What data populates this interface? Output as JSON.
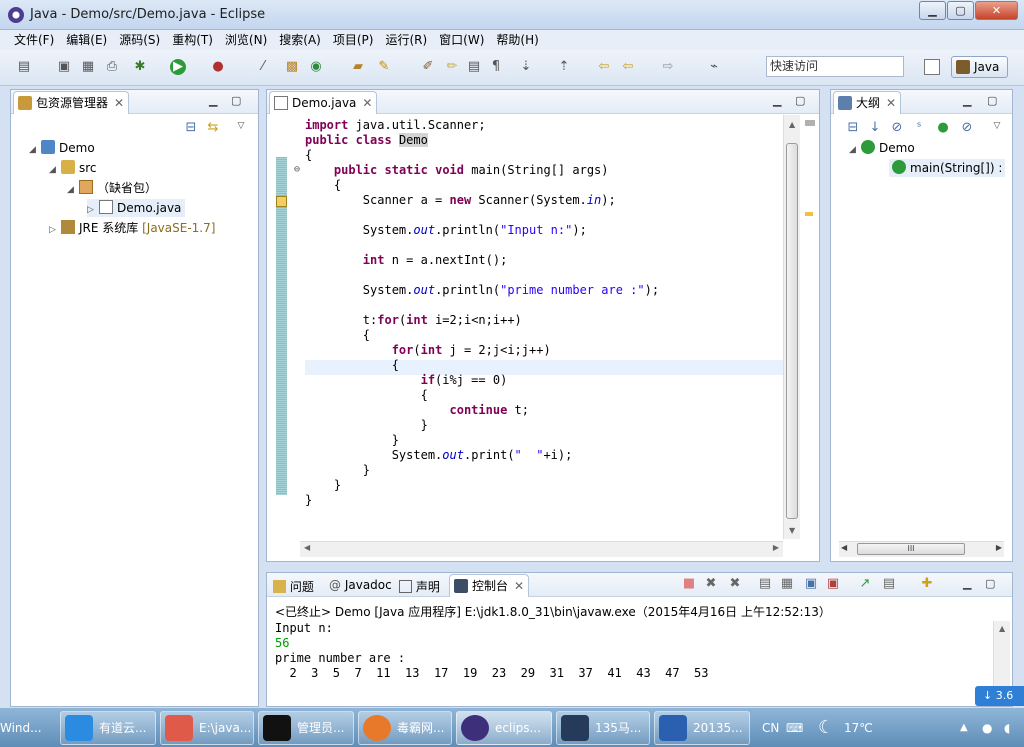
{
  "window": {
    "title": "Java  -  Demo/src/Demo.java  -  Eclipse"
  },
  "menu": [
    "文件(F)",
    "编辑(E)",
    "源码(S)",
    "重构(T)",
    "浏览(N)",
    "搜索(A)",
    "项目(P)",
    "运行(R)",
    "窗口(W)",
    "帮助(H)"
  ],
  "toolbar": {
    "quick_access_value": "快速访问",
    "perspective_label": "Java"
  },
  "package_explorer": {
    "tab_label": "包资源管理器",
    "tree": [
      {
        "label": "Demo"
      },
      {
        "label": "src"
      },
      {
        "label": "（缺省包）"
      },
      {
        "label": "Demo.java"
      },
      {
        "label": "JRE 系统库",
        "decoration": "[JavaSE-1.7]"
      }
    ]
  },
  "editor": {
    "tab_label": "Demo.java",
    "lines": [
      "import java.util.Scanner;",
      "public class Demo",
      "{",
      "    public static void main(String[] args)",
      "    {",
      "        Scanner a = new Scanner(System.in);",
      "",
      "        System.out.println(\"Input n:\");",
      "",
      "        int n = a.nextInt();",
      "",
      "        System.out.println(\"prime number are :\");",
      "",
      "        t:for(int i=2;i<n;i++)",
      "        {",
      "            for(int j = 2;j<i;j++)",
      "            {",
      "                if(i%j == 0)",
      "                {",
      "                    continue t;",
      "                }",
      "            }",
      "            System.out.print(\"  \"+i);",
      "        }",
      "    }",
      "}"
    ]
  },
  "outline": {
    "tab_label": "大纲",
    "items": [
      {
        "label": "Demo"
      },
      {
        "label": "main(String[]) :"
      }
    ],
    "hscroll_label": "III"
  },
  "console": {
    "tabs": [
      "问题",
      "Javadoc",
      "声明",
      "控制台"
    ],
    "header": "<已终止> Demo [Java 应用程序] E:\\jdk1.8.0_31\\bin\\javaw.exe（2015年4月16日 上午12:52:13）",
    "output_lines": [
      {
        "text": "Input n:",
        "color": "#000000"
      },
      {
        "text": "56",
        "color": "#00a000"
      },
      {
        "text": "prime number are :",
        "color": "#000000"
      },
      {
        "text": "  2  3  5  7  11  13  17  19  23  29  31  37  41  43  47  53",
        "color": "#000000"
      }
    ]
  },
  "taskbar": {
    "start_label": "Wind...",
    "items": [
      "有道云...",
      "E:\\java...",
      "管理员...",
      "毒霸网...",
      "eclips...",
      "135马...",
      "20135..."
    ],
    "tray_lang": "CN",
    "temperature": "17℃",
    "notify_value": "3.6"
  }
}
